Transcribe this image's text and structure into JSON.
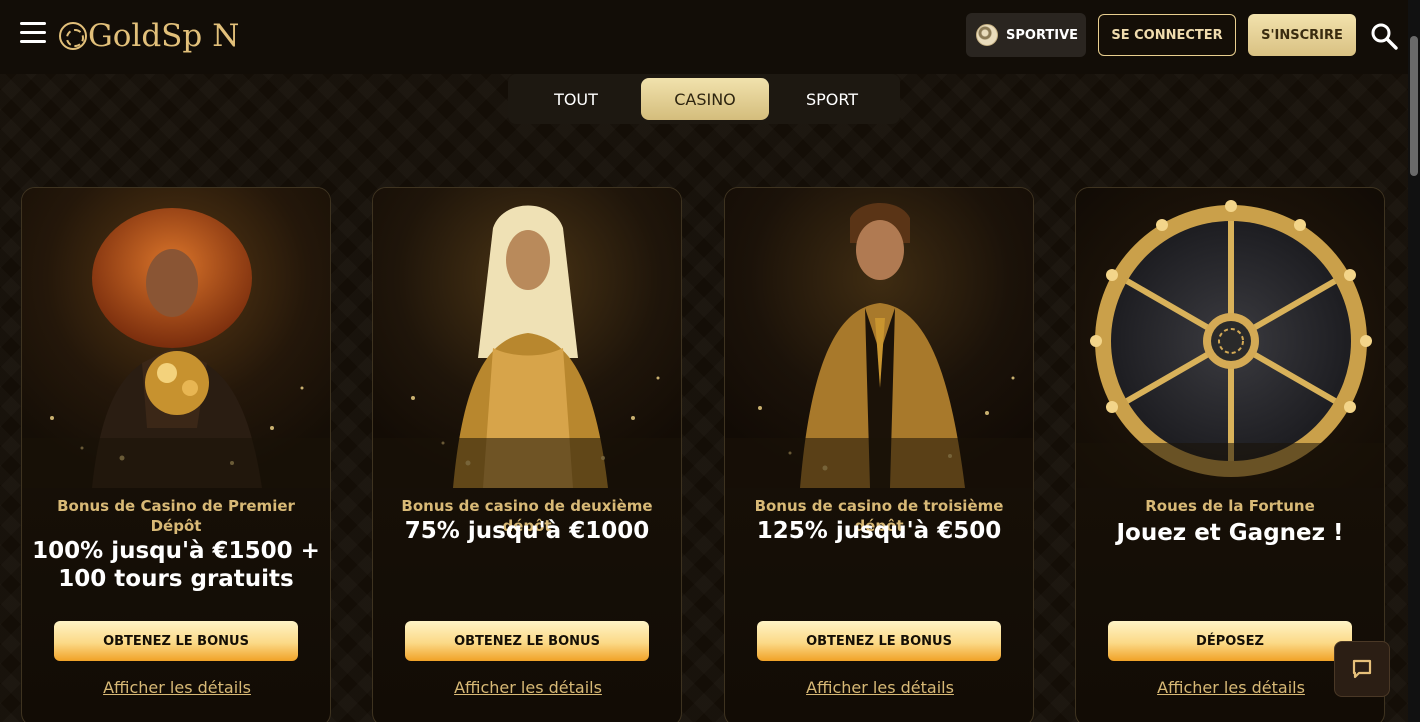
{
  "header": {
    "logo_text_1": "GoldSp",
    "logo_text_2": "N",
    "sportive_label": "SPORTIVE",
    "login_label": "SE CONNECTER",
    "signup_label": "S'INSCRIRE"
  },
  "tabs": [
    {
      "label": "TOUT",
      "active": false
    },
    {
      "label": "CASINO",
      "active": true
    },
    {
      "label": "SPORT",
      "active": false
    }
  ],
  "cards": [
    {
      "title": "Bonus de Casino de Premier Dépôt",
      "offer": "100% jusqu'à €1500 + 100 tours gratuits",
      "button": "OBTENEZ LE BONUS",
      "link": "Afficher les détails"
    },
    {
      "title": "Bonus de casino de deuxième dépôt",
      "offer": "75% jusqu'à €1000",
      "button": "OBTENEZ LE BONUS",
      "link": "Afficher les détails"
    },
    {
      "title": "Bonus de casino de troisième dépôt",
      "offer": "125% jusqu'à €500",
      "button": "OBTENEZ LE BONUS",
      "link": "Afficher les détails"
    },
    {
      "title": "Roues de la Fortune",
      "offer": "Jouez et Gagnez !",
      "button": "DÉPOSEZ",
      "link": "Afficher les détails"
    }
  ],
  "colors": {
    "gold": "#d8b976",
    "background": "#150f08",
    "button_gradient_top": "#fff4c6",
    "button_gradient_bottom": "#f1a227"
  },
  "icons": [
    "menu-icon",
    "logo-spin-icon",
    "soccer-ball-icon",
    "search-icon",
    "chat-icon"
  ]
}
